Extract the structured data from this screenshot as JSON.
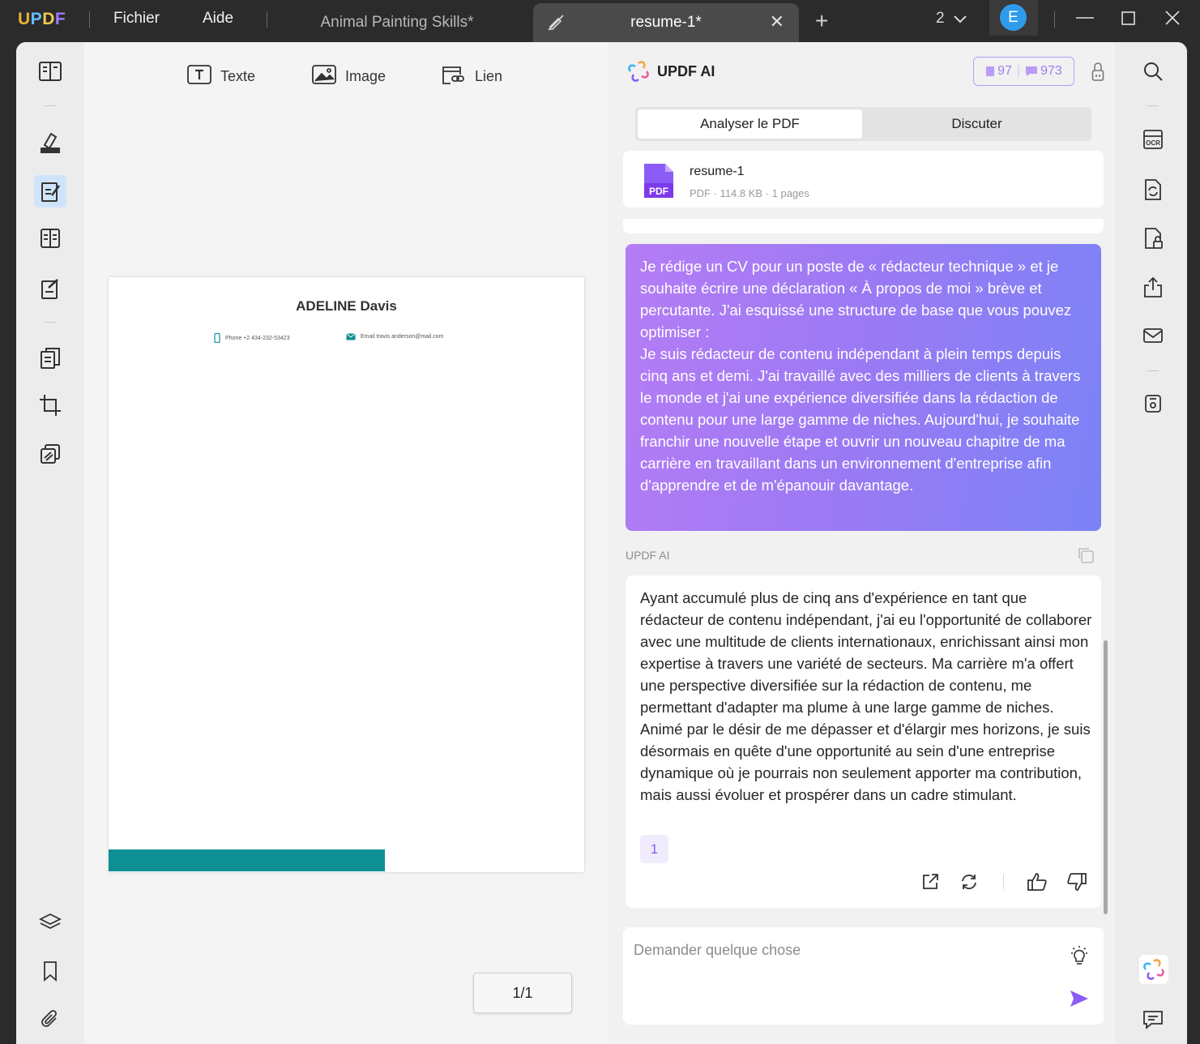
{
  "titlebar": {
    "logo": [
      "U",
      "P",
      "D",
      "F"
    ],
    "menu": [
      "Fichier",
      "Aide"
    ],
    "tabs": [
      {
        "label": "Animal Painting Skills*",
        "active": false
      },
      {
        "label": "resume-1*",
        "active": true
      }
    ],
    "window_count": "2",
    "avatar_letter": "E"
  },
  "toolbar": {
    "text_label": "Texte",
    "image_label": "Image",
    "link_label": "Lien"
  },
  "document": {
    "name": "ADELINE Davis",
    "phone": "Phone   +2 434-232-53423",
    "email": "Email travis anderson@mail.com",
    "accent_color": "#0d8f93"
  },
  "pager": {
    "label": "1/1"
  },
  "ai_panel": {
    "title": "UPDF AI",
    "credits_docs": "97",
    "credits_chat": "973",
    "tabs": [
      "Analyser le PDF",
      "Discuter"
    ],
    "file": {
      "name": "resume-1",
      "meta": "PDF · 114.8 KB · 1 pages",
      "icon_label": "PDF"
    },
    "user_message": "Je rédige un CV pour un poste de « rédacteur technique » et je souhaite écrire une déclaration « À propos de moi » brève et percutante. J'ai esquissé une structure de base que vous pouvez optimiser :\nJe suis rédacteur de contenu indépendant à plein temps depuis cinq ans et demi. J'ai travaillé avec des milliers de clients à travers le monde et j'ai une expérience diversifiée dans la rédaction de contenu pour une large gamme de niches. Aujourd'hui, je souhaite franchir une nouvelle étape et ouvrir un nouveau chapitre de ma carrière en travaillant dans un environnement d'entreprise afin d'apprendre et de m'épanouir davantage.",
    "ai_label": "UPDF AI",
    "ai_response": "Ayant accumulé plus de cinq ans d'expérience en tant que rédacteur de contenu indépendant, j'ai eu l'opportunité de collaborer avec une multitude de clients internationaux, enrichissant ainsi mon expertise à travers une variété de secteurs. Ma carrière m'a offert une perspective diversifiée sur la rédaction de contenu, me permettant d'adapter ma plume à une large gamme de niches. Animé par le désir de me dépasser et d'élargir mes horizons, je suis désormais en quête d'une opportunité au sein d'une entreprise dynamique où je pourrais non seulement apporter ma contribution, mais aussi évoluer et prospérer dans un cadre stimulant.",
    "reference": "1",
    "input_placeholder": "Demander quelque chose",
    "accent_gradient": [
      "#b57cf5",
      "#7b83f6"
    ]
  },
  "icons": {
    "left": [
      "reader-icon",
      "comment-icon",
      "edit-pdf-icon",
      "form-icon",
      "fill-sign-icon",
      "organize-pages-icon",
      "crop-icon",
      "protect-icon",
      "layers-icon",
      "bookmark-icon",
      "attachment-icon"
    ],
    "right": [
      "search-icon",
      "ocr-icon",
      "convert-icon",
      "protect-icon",
      "share-icon",
      "email-icon",
      "save-icon",
      "updf-ai-icon",
      "comments-icon"
    ]
  }
}
